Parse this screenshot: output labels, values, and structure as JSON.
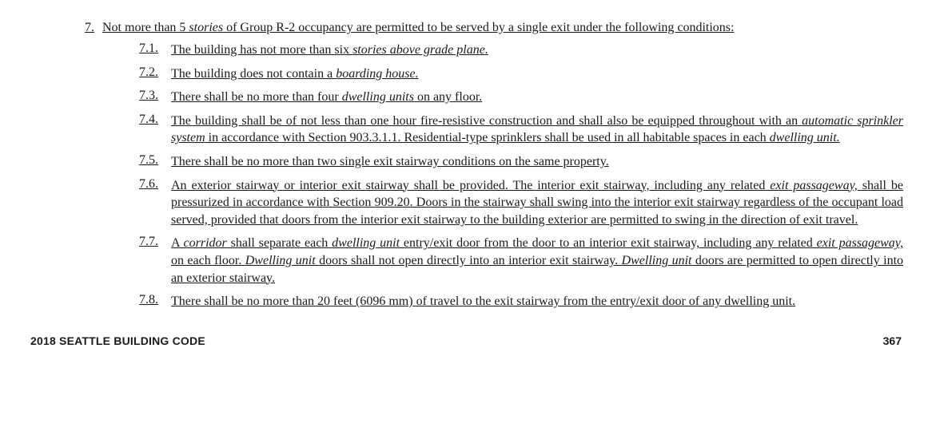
{
  "main": {
    "number": "7.",
    "text_parts": [
      {
        "t": "Not more than 5 ",
        "i": false
      },
      {
        "t": "stories",
        "i": true
      },
      {
        "t": " of Group R-2 occupancy are permitted to be served by a single exit under the following conditions:",
        "i": false
      }
    ]
  },
  "subs": [
    {
      "number": "7.1.",
      "text_parts": [
        {
          "t": "The building has not more than six ",
          "i": false
        },
        {
          "t": "stories above grade plane.",
          "i": true
        }
      ]
    },
    {
      "number": "7.2.",
      "text_parts": [
        {
          "t": "The building does not contain a ",
          "i": false
        },
        {
          "t": "boarding house.",
          "i": true
        }
      ]
    },
    {
      "number": "7.3.",
      "text_parts": [
        {
          "t": "There shall be no more than four ",
          "i": false
        },
        {
          "t": "dwelling units",
          "i": true
        },
        {
          "t": " on any floor.",
          "i": false
        }
      ]
    },
    {
      "number": "7.4.",
      "text_parts": [
        {
          "t": "The building shall be of not less than one hour fire-resistive construction and shall also be equipped throughout with an ",
          "i": false
        },
        {
          "t": "automatic sprinkler system",
          "i": true
        },
        {
          "t": " in accordance with Section 903.3.1.1. Residential-type sprinklers shall be used in all habitable spaces in each ",
          "i": false
        },
        {
          "t": "dwelling unit.",
          "i": true
        }
      ]
    },
    {
      "number": "7.5.",
      "text_parts": [
        {
          "t": "There shall be no more than two single exit stairway conditions on the same property.",
          "i": false
        }
      ]
    },
    {
      "number": "7.6.",
      "text_parts": [
        {
          "t": "An exterior stairway or interior exit stairway shall be provided. The interior exit stairway, including any related ",
          "i": false
        },
        {
          "t": "exit passageway,",
          "i": true
        },
        {
          "t": " shall be pressurized in accordance with Section 909.20. Doors in the stairway shall swing into the interior exit stairway regardless of the occupant load served, provided that doors from the interior exit stairway to the building exterior are permitted to swing in the direction of exit travel.",
          "i": false
        }
      ]
    },
    {
      "number": "7.7.",
      "text_parts": [
        {
          "t": "A ",
          "i": false
        },
        {
          "t": "corridor",
          "i": true
        },
        {
          "t": " shall separate each ",
          "i": false
        },
        {
          "t": "dwelling unit",
          "i": true
        },
        {
          "t": " entry/exit door from the door to an interior exit stairway, including any related ",
          "i": false
        },
        {
          "t": "exit passageway,",
          "i": true
        },
        {
          "t": " on each floor. ",
          "i": false
        },
        {
          "t": "Dwelling unit",
          "i": true
        },
        {
          "t": " doors shall not open directly into an interior exit stairway. ",
          "i": false
        },
        {
          "t": "Dwelling unit",
          "i": true
        },
        {
          "t": " doors are permitted to open directly into an exterior stairway.",
          "i": false
        }
      ]
    },
    {
      "number": "7.8.",
      "text_parts": [
        {
          "t": "There shall be no more than 20 feet (6096 mm) of travel to the exit stairway from the entry/exit door of any dwelling unit.",
          "i": false
        }
      ]
    }
  ],
  "footer": {
    "left": "2018 SEATTLE BUILDING CODE",
    "right": "367"
  }
}
